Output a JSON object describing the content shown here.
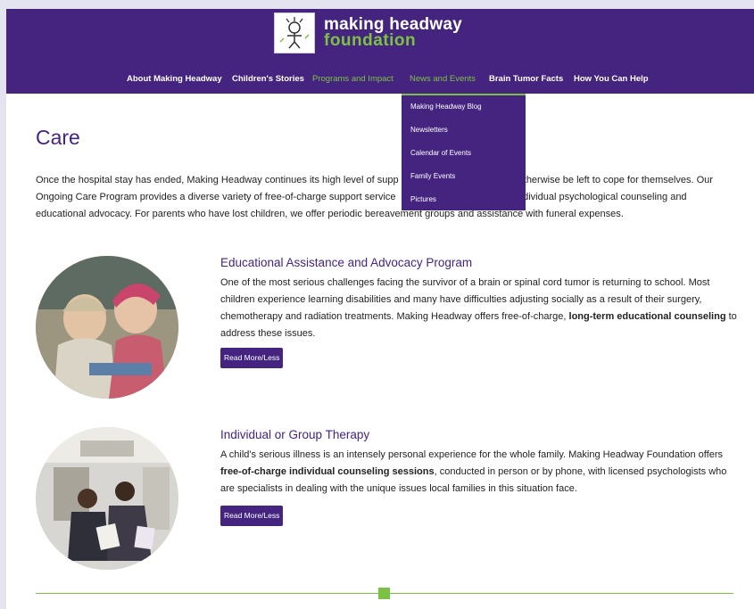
{
  "brand": {
    "line1": "making headway",
    "line2": "foundation"
  },
  "nav": {
    "items": [
      "About Making Headway",
      "Children's Stories",
      "Programs and Impact",
      "News and Events",
      "Brain Tumor Facts",
      "How You Can Help"
    ]
  },
  "dropdown": {
    "items": [
      "Making Headway Blog",
      "Newsletters",
      "Calendar of Events",
      "Family Events",
      "Pictures"
    ]
  },
  "main": {
    "title": "Care",
    "intro_lines": [
      "Once the hospital stay has ended, Making Headway continues its high level of supp",
      "otherwise be left to cope for themselves. Our",
      "Ongoing Care Program provides a diverse variety of free-of-charge support service",
      "individual psychological counseling and",
      "educational advocacy. For parents who have lost children, we offer periodic bereavement groups and assistance with funeral expenses."
    ],
    "sections": [
      {
        "title": "Educational Assistance and Advocacy Program",
        "body_text": "One of the most serious challenges facing the survivor of a brain or spinal cord tumor is returning to school. Most children experience learning disabilities and many have difficulties adjusting socially as a result of their surgery, chemotherapy and radiation treatments. Making Headway offers free-of-charge,",
        "body_bold": "long-term educational counseling",
        "body_end": "to address these issues.",
        "button": "Read More/Less"
      },
      {
        "title": "Individual or Group Therapy",
        "body_text": "A child's serious illness is an intensely personal experience for the whole family. Making Headway Foundation offers",
        "body_bold": "free-of-charge individual counseling sessions",
        "body_end": ", conducted in person or by phone, with licensed psychologists who are specialists in dealing with the unique issues local families in this situation face.",
        "button": "Read More/Less"
      }
    ]
  },
  "colors": {
    "brand_purple": "#452480",
    "brand_green": "#7cc242"
  }
}
